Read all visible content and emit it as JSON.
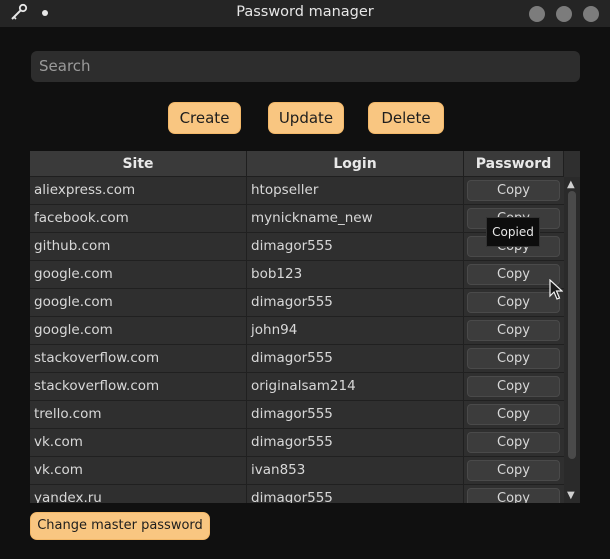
{
  "window": {
    "title": "Password manager"
  },
  "search": {
    "placeholder": "Search"
  },
  "actions": {
    "create": "Create",
    "update": "Update",
    "delete": "Delete"
  },
  "table": {
    "headers": [
      "Site",
      "Login",
      "Password"
    ],
    "copy_label": "Copy",
    "rows": [
      {
        "site": "aliexpress.com",
        "login": "htopseller"
      },
      {
        "site": "facebook.com",
        "login": "mynickname_new"
      },
      {
        "site": "github.com",
        "login": "dimagor555"
      },
      {
        "site": "google.com",
        "login": "bob123"
      },
      {
        "site": "google.com",
        "login": "dimagor555"
      },
      {
        "site": "google.com",
        "login": "john94"
      },
      {
        "site": "stackoverflow.com",
        "login": "dimagor555"
      },
      {
        "site": "stackoverflow.com",
        "login": "originalsam214"
      },
      {
        "site": "trello.com",
        "login": "dimagor555"
      },
      {
        "site": "vk.com",
        "login": "dimagor555"
      },
      {
        "site": "vk.com",
        "login": "ivan853"
      },
      {
        "site": "yandex.ru",
        "login": "dimagor555"
      }
    ]
  },
  "tooltip": {
    "text": "Copied"
  },
  "footer": {
    "change_master_label": "Change master password"
  },
  "colors": {
    "accent": "#f9c681",
    "background": "#101010",
    "table_bg": "#2f2f2f"
  }
}
